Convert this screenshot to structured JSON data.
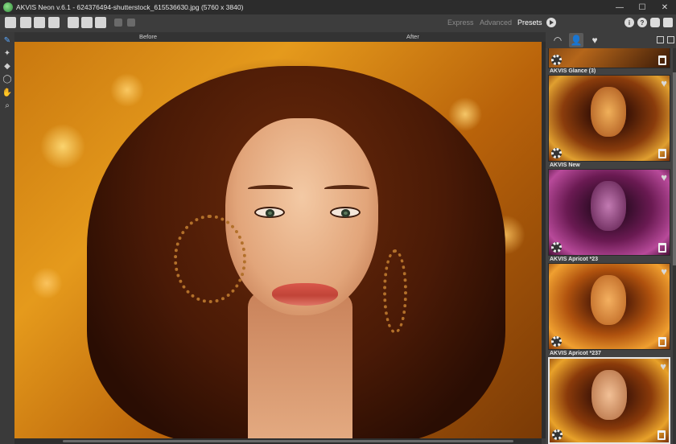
{
  "window": {
    "title": "AKVIS Neon v.6.1 - 624376494-shutterstock_615536630.jpg (5760 x 3840)",
    "controls": {
      "minimize": "—",
      "maximize": "☐",
      "close": "✕"
    }
  },
  "toolbar": {
    "modes": [
      "Express",
      "Advanced",
      "Presets"
    ],
    "active_mode": "Presets",
    "icons": [
      "open-icon",
      "save-icon",
      "save-as-icon",
      "print-icon",
      "batch-icon",
      "plugin-icon",
      "share-icon",
      "undo-icon",
      "redo-icon",
      "run-icon",
      "info-icon",
      "help-icon",
      "settings-icon",
      "notification-icon"
    ],
    "info_label": "i",
    "help_label": "?"
  },
  "canvas": {
    "before_label": "Before",
    "after_label": "After"
  },
  "left_tools": {
    "items": [
      "neon-brush-icon",
      "recovery-brush-icon",
      "eraser-icon",
      "lasso-icon",
      "hand-icon",
      "zoom-icon"
    ],
    "active": "neon-brush-icon",
    "glyphs": [
      "✎",
      "✦",
      "◆",
      "◯",
      "✋",
      "⌕"
    ]
  },
  "presets_panel": {
    "tabs": [
      "all-presets-icon",
      "user-presets-icon",
      "favorites-icon"
    ],
    "active_tab": "user-presets-icon",
    "tab_glyphs": [
      "◠",
      "👤",
      "♥"
    ],
    "heart_glyph": "♥",
    "items": [
      {
        "name": "AKVIS Glance (3)",
        "selected": false,
        "favorite": false,
        "palette": "gold"
      },
      {
        "name": "AKVIS New",
        "selected": false,
        "favorite": false,
        "palette": "violet"
      },
      {
        "name": "AKVIS Apricot *23",
        "selected": false,
        "favorite": false,
        "palette": "orange"
      },
      {
        "name": "AKVIS Apricot *237",
        "selected": true,
        "favorite": false,
        "palette": "amber"
      }
    ]
  },
  "colors": {
    "accent_active_tool": "#5aa8ff",
    "panel_bg": "#424242",
    "toolbar_bg": "#3d3d3d"
  }
}
